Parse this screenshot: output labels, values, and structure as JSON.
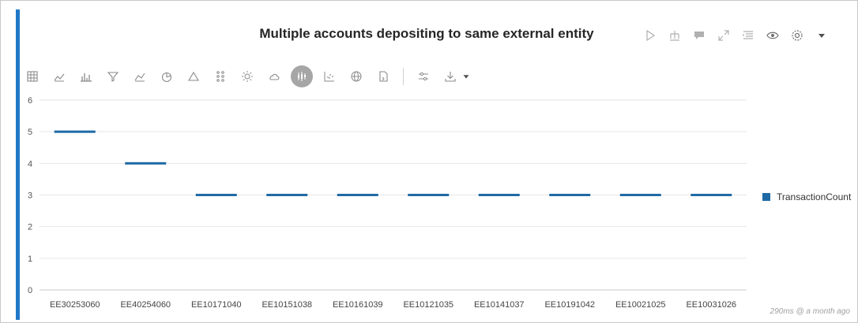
{
  "title": "Multiple accounts depositing to same external entity",
  "title_actions": [
    "play-icon",
    "hierarchy-icon",
    "comment-icon",
    "expand-icon",
    "list-icon",
    "eye-icon",
    "settings-icon",
    "caret-down-icon"
  ],
  "toolbar_icons": [
    "table-icon",
    "line-chart-icon",
    "bar-chart-icon",
    "funnel-icon",
    "area-chart-icon",
    "pie-chart-icon",
    "triangle-icon",
    "dots-icon",
    "sun-icon",
    "cloud-icon",
    "candlestick-icon",
    "scatter-icon",
    "globe-icon",
    "card-icon"
  ],
  "toolbar_actions": [
    "filter-sliders-icon",
    "download-icon",
    "caret-down-icon"
  ],
  "active_tool": "candlestick-icon",
  "colors": {
    "accent": "#1e78c8",
    "series": "#1f6aa5",
    "grid": "#e6e6e6"
  },
  "footer_timing": "290ms @ a month ago",
  "chart_data": {
    "type": "bar",
    "categories": [
      "EE30253060",
      "EE40254060",
      "EE10171040",
      "EE10151038",
      "EE10161039",
      "EE10121035",
      "EE10141037",
      "EE10191042",
      "EE10021025",
      "EE10031026"
    ],
    "series": [
      {
        "name": "TransactionCount",
        "values": [
          5,
          4,
          3,
          3,
          3,
          3,
          3,
          3,
          3,
          3
        ]
      }
    ],
    "ylim": [
      0,
      6
    ],
    "yticks": [
      "0",
      "1",
      "2",
      "3",
      "4",
      "5",
      "6"
    ],
    "grid": true,
    "legend_position": "right"
  }
}
